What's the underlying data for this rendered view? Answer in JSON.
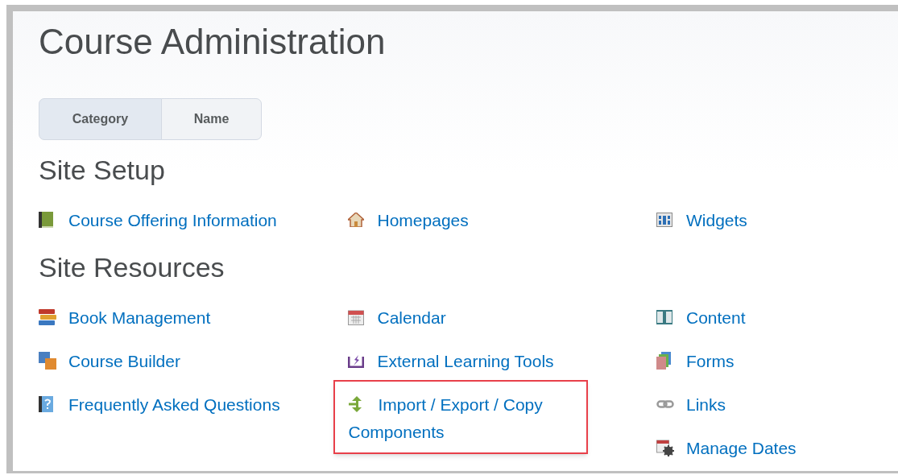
{
  "page": {
    "title": "Course Administration"
  },
  "view_toggle": [
    {
      "label": "Category",
      "selected": true
    },
    {
      "label": "Name",
      "selected": false
    }
  ],
  "sections": [
    {
      "title": "Site Setup",
      "columns": [
        [
          {
            "label": "Course Offering Information",
            "highlighted": false
          }
        ],
        [
          {
            "label": "Homepages",
            "highlighted": false
          }
        ],
        [
          {
            "label": "Widgets",
            "highlighted": false
          }
        ]
      ]
    },
    {
      "title": "Site Resources",
      "columns": [
        [
          {
            "label": "Book Management",
            "highlighted": false
          },
          {
            "label": "Course Builder",
            "highlighted": false
          },
          {
            "label": "Frequently Asked Questions",
            "highlighted": false
          }
        ],
        [
          {
            "label": "Calendar",
            "highlighted": false
          },
          {
            "label": "External Learning Tools",
            "highlighted": false
          },
          {
            "label": "Import / Export / Copy Components",
            "highlighted": true
          }
        ],
        [
          {
            "label": "Content",
            "highlighted": false
          },
          {
            "label": "Forms",
            "highlighted": false
          },
          {
            "label": "Links",
            "highlighted": false
          },
          {
            "label": "Manage Dates",
            "highlighted": false
          }
        ]
      ]
    }
  ]
}
